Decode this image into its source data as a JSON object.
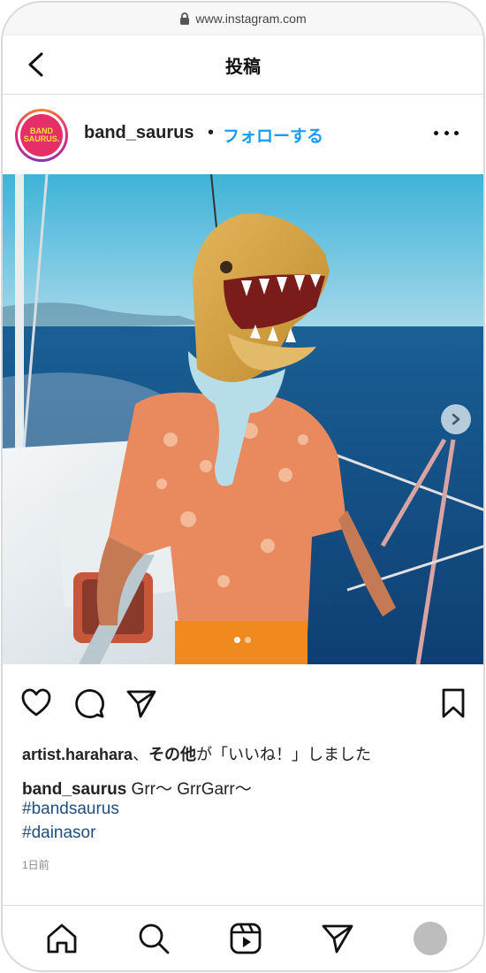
{
  "browser": {
    "url": "www.instagram.com"
  },
  "header": {
    "title": "投稿"
  },
  "post": {
    "avatar_text_line1": "BAND",
    "avatar_text_line2": "SAURUS.",
    "username": "band_saurus",
    "separator": "•",
    "follow_label": "フォローする",
    "likes": {
      "user": "artist.harahara",
      "connector": "、",
      "others": "その他",
      "suffix": "が「いいね！」しました"
    },
    "caption": {
      "username": "band_saurus",
      "text": " Grr〜 GrrGarr〜"
    },
    "hashtags": [
      "#bandsaurus",
      "#dainasor"
    ],
    "time_ago": "1日前",
    "carousel": {
      "current": 1,
      "total": 2
    }
  },
  "icons": {
    "back": "chevron-left-icon",
    "more": "more-horizontal-icon",
    "like": "heart-icon",
    "comment": "comment-icon",
    "share": "paper-plane-icon",
    "save": "bookmark-icon",
    "next": "chevron-right-icon",
    "home": "home-icon",
    "search": "search-icon",
    "reels": "reels-icon",
    "direct": "paper-plane-icon"
  },
  "colors": {
    "accent": "#1a9cf0",
    "hashtag": "#1f4f7e",
    "avatar_bg": "#e52f68",
    "avatar_text": "#f6e03a"
  }
}
